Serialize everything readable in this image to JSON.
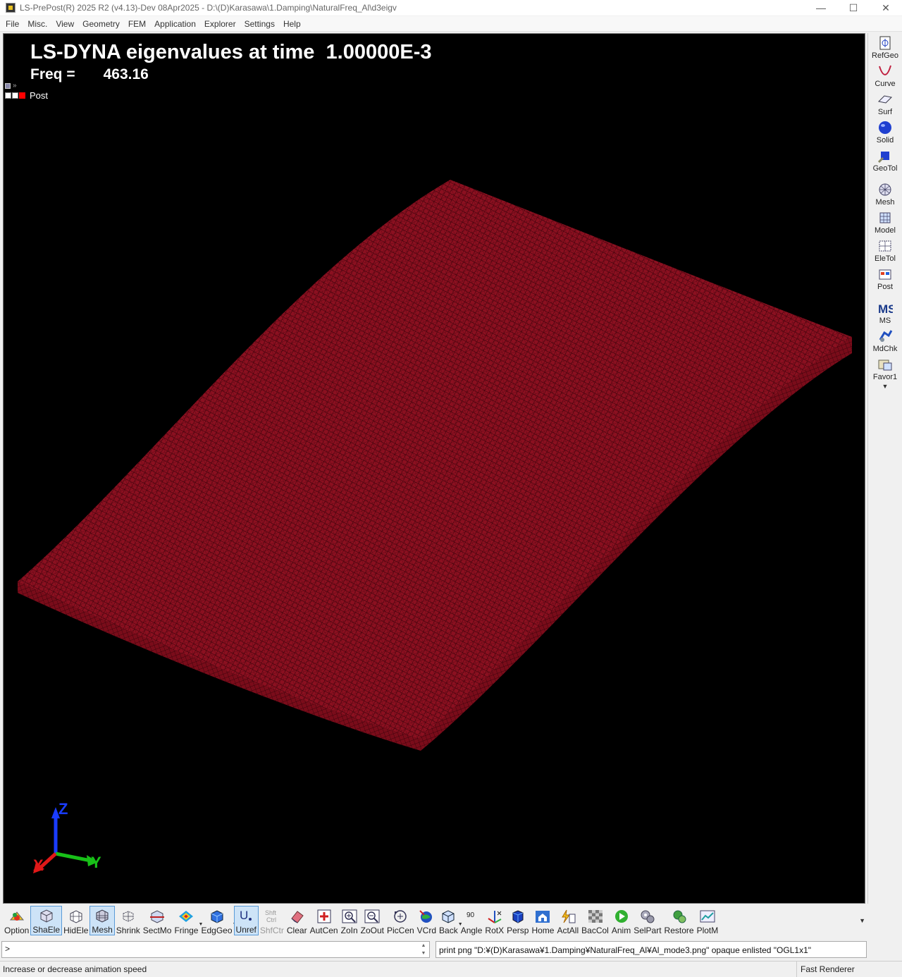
{
  "window": {
    "title": "LS-PrePost(R) 2025 R2 (v4.13)-Dev 08Apr2025 - D:\\(D)Karasawa\\1.Damping\\NaturalFreq_Al\\d3eigv",
    "minimize": "—",
    "maximize": "☐",
    "close": "✕"
  },
  "menu": [
    "File",
    "Misc.",
    "View",
    "Geometry",
    "FEM",
    "Application",
    "Explorer",
    "Settings",
    "Help"
  ],
  "viewport": {
    "title": "LS-DYNA eigenvalues at time  1.00000E-3",
    "freq_label": "Freq =",
    "freq_value": "463.16",
    "post_label": "Post",
    "model_color": "#8b1020",
    "axis_labels": {
      "z": "Z",
      "x": "X",
      "y": "Y"
    }
  },
  "right_toolbar": [
    {
      "label": "RefGeo",
      "icon": "refgeo-icon"
    },
    {
      "label": "Curve",
      "icon": "curve-icon"
    },
    {
      "label": "Surf",
      "icon": "surface-icon"
    },
    {
      "label": "Solid",
      "icon": "solid-icon"
    },
    {
      "label": "GeoTol",
      "icon": "geotol-icon"
    },
    {
      "label": "Mesh",
      "icon": "mesh-icon"
    },
    {
      "label": "Model",
      "icon": "model-icon"
    },
    {
      "label": "EleTol",
      "icon": "eletol-icon"
    },
    {
      "label": "Post",
      "icon": "post-icon"
    },
    {
      "label": "MS",
      "icon": "ms-icon"
    },
    {
      "label": "MdChk",
      "icon": "mdchk-icon"
    },
    {
      "label": "Favor1",
      "icon": "favorite-icon"
    }
  ],
  "bottom_toolbar": [
    {
      "label": "Option",
      "active": false
    },
    {
      "label": "ShaEle",
      "active": true
    },
    {
      "label": "HidEle",
      "active": false
    },
    {
      "label": "Mesh",
      "active": true
    },
    {
      "label": "Shrink",
      "active": false
    },
    {
      "label": "SectMo",
      "active": false
    },
    {
      "label": "Fringe",
      "active": false
    },
    {
      "label": "EdgGeo",
      "active": false
    },
    {
      "label": "Unref",
      "active": true
    },
    {
      "label": "ShfCtr",
      "active": false
    },
    {
      "label": "Clear",
      "active": false
    },
    {
      "label": "AutCen",
      "active": false
    },
    {
      "label": "ZoIn",
      "active": false
    },
    {
      "label": "ZoOut",
      "active": false
    },
    {
      "label": "PicCen",
      "active": false
    },
    {
      "label": "VCrd",
      "active": false
    },
    {
      "label": "Back",
      "active": false
    },
    {
      "label": "Angle",
      "active": false
    },
    {
      "label": "RotX",
      "active": false
    },
    {
      "label": "Persp",
      "active": false
    },
    {
      "label": "Home",
      "active": false
    },
    {
      "label": "ActAll",
      "active": false
    },
    {
      "label": "BacCol",
      "active": false
    },
    {
      "label": "Anim",
      "active": false
    },
    {
      "label": "SelPart",
      "active": false
    },
    {
      "label": "Restore",
      "active": false
    },
    {
      "label": "PlotM",
      "active": false
    }
  ],
  "toolbar_extras": {
    "shfctr_top": "Shft",
    "shfctr_mid": "Ctrl",
    "angle_value": "90",
    "unref_glyph": "U"
  },
  "command": {
    "prompt": ">",
    "history": "print png \"D:¥(D)Karasawa¥1.Damping¥NaturalFreq_Al¥Al_mode3.png\" opaque enlisted \"OGL1x1\""
  },
  "status": {
    "message": "Increase or decrease animation speed",
    "renderer": "Fast Renderer"
  }
}
